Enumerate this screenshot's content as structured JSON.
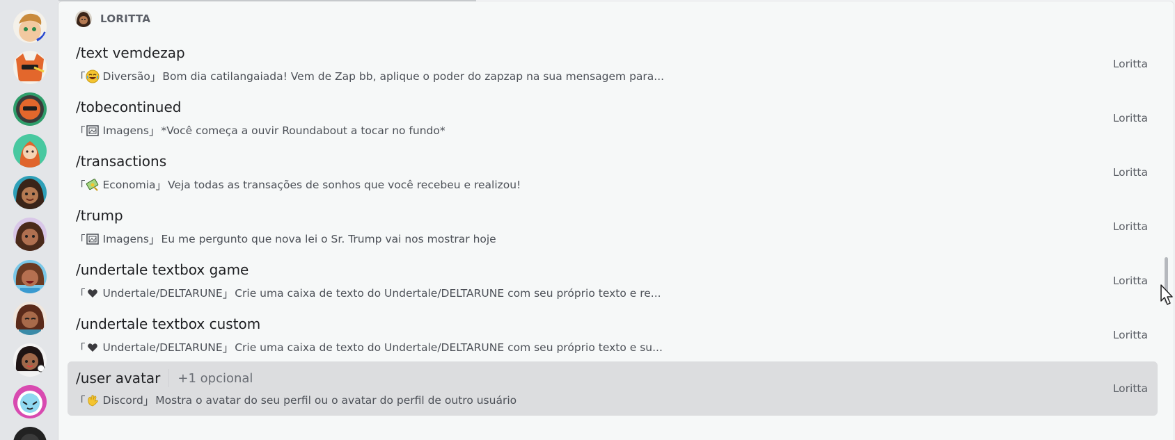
{
  "server_rail": {
    "servers": [
      {
        "icon": "avatar-1",
        "color": "#f2d3a8"
      },
      {
        "icon": "avatar-2",
        "color": "#e3672c"
      },
      {
        "icon": "avatar-3",
        "color": "#2e9e6b"
      },
      {
        "icon": "avatar-4",
        "color": "#48c8a0"
      },
      {
        "icon": "avatar-5",
        "color": "#2ea0b8"
      },
      {
        "icon": "avatar-6",
        "color": "#8a5a4a"
      },
      {
        "icon": "avatar-7",
        "color": "#6a4a3a"
      },
      {
        "icon": "avatar-8",
        "color": "#9a5a4a"
      },
      {
        "icon": "avatar-9",
        "color": "#3a2a2a"
      },
      {
        "icon": "avatar-10",
        "color": "#7ad0e0"
      },
      {
        "icon": "avatar-11",
        "color": "#222222"
      }
    ]
  },
  "group": {
    "name": "LORITTA"
  },
  "commands": [
    {
      "name": "/text vemdezap",
      "optional": "",
      "bracket_open": "「",
      "bracket_close": "」",
      "category_icon": "laughing-face-icon",
      "category": "Diversão",
      "description": "Bom dia catilangaiada! Vem de Zap bb, aplique o poder do zapzap na sua mensagem para...",
      "source": "Loritta"
    },
    {
      "name": "/tobecontinued",
      "optional": "",
      "bracket_open": "「",
      "bracket_close": "」",
      "category_icon": "framed-picture-icon",
      "category": "Imagens",
      "description": "*Você começa a ouvir Roundabout a tocar no fundo*",
      "source": "Loritta"
    },
    {
      "name": "/transactions",
      "optional": "",
      "bracket_open": "「",
      "bracket_close": "」",
      "category_icon": "money-icon",
      "category": "Economia",
      "description": "Veja todas as transações de sonhos que você recebeu e realizou!",
      "source": "Loritta"
    },
    {
      "name": "/trump",
      "optional": "",
      "bracket_open": "「",
      "bracket_close": "」",
      "category_icon": "framed-picture-icon",
      "category": "Imagens",
      "description": "Eu me pergunto que nova lei o Sr. Trump vai nos mostrar hoje",
      "source": "Loritta"
    },
    {
      "name": "/undertale textbox game",
      "optional": "",
      "bracket_open": "「",
      "bracket_close": "」",
      "category_icon": "black-heart-icon",
      "category": "Undertale/DELTARUNE",
      "description": "Crie uma caixa de texto do Undertale/DELTARUNE com seu próprio texto e re...",
      "source": "Loritta"
    },
    {
      "name": "/undertale textbox custom",
      "optional": "",
      "bracket_open": "「",
      "bracket_close": "」",
      "category_icon": "black-heart-icon",
      "category": "Undertale/DELTARUNE",
      "description": "Crie uma caixa de texto do Undertale/DELTARUNE com seu próprio texto e su...",
      "source": "Loritta"
    },
    {
      "name": "/user avatar",
      "optional": "+1 opcional",
      "bracket_open": "「",
      "bracket_close": "」",
      "category_icon": "waving-hand-icon",
      "category": "Discord",
      "description": "Mostra o avatar do seu perfil ou o avatar do perfil de outro usuário",
      "source": "Loritta",
      "selected": true
    }
  ],
  "colors": {
    "selected_row": "#dcdddf",
    "panel_bg": "#f6f8f8",
    "rail_bg": "#e3e5e8"
  }
}
